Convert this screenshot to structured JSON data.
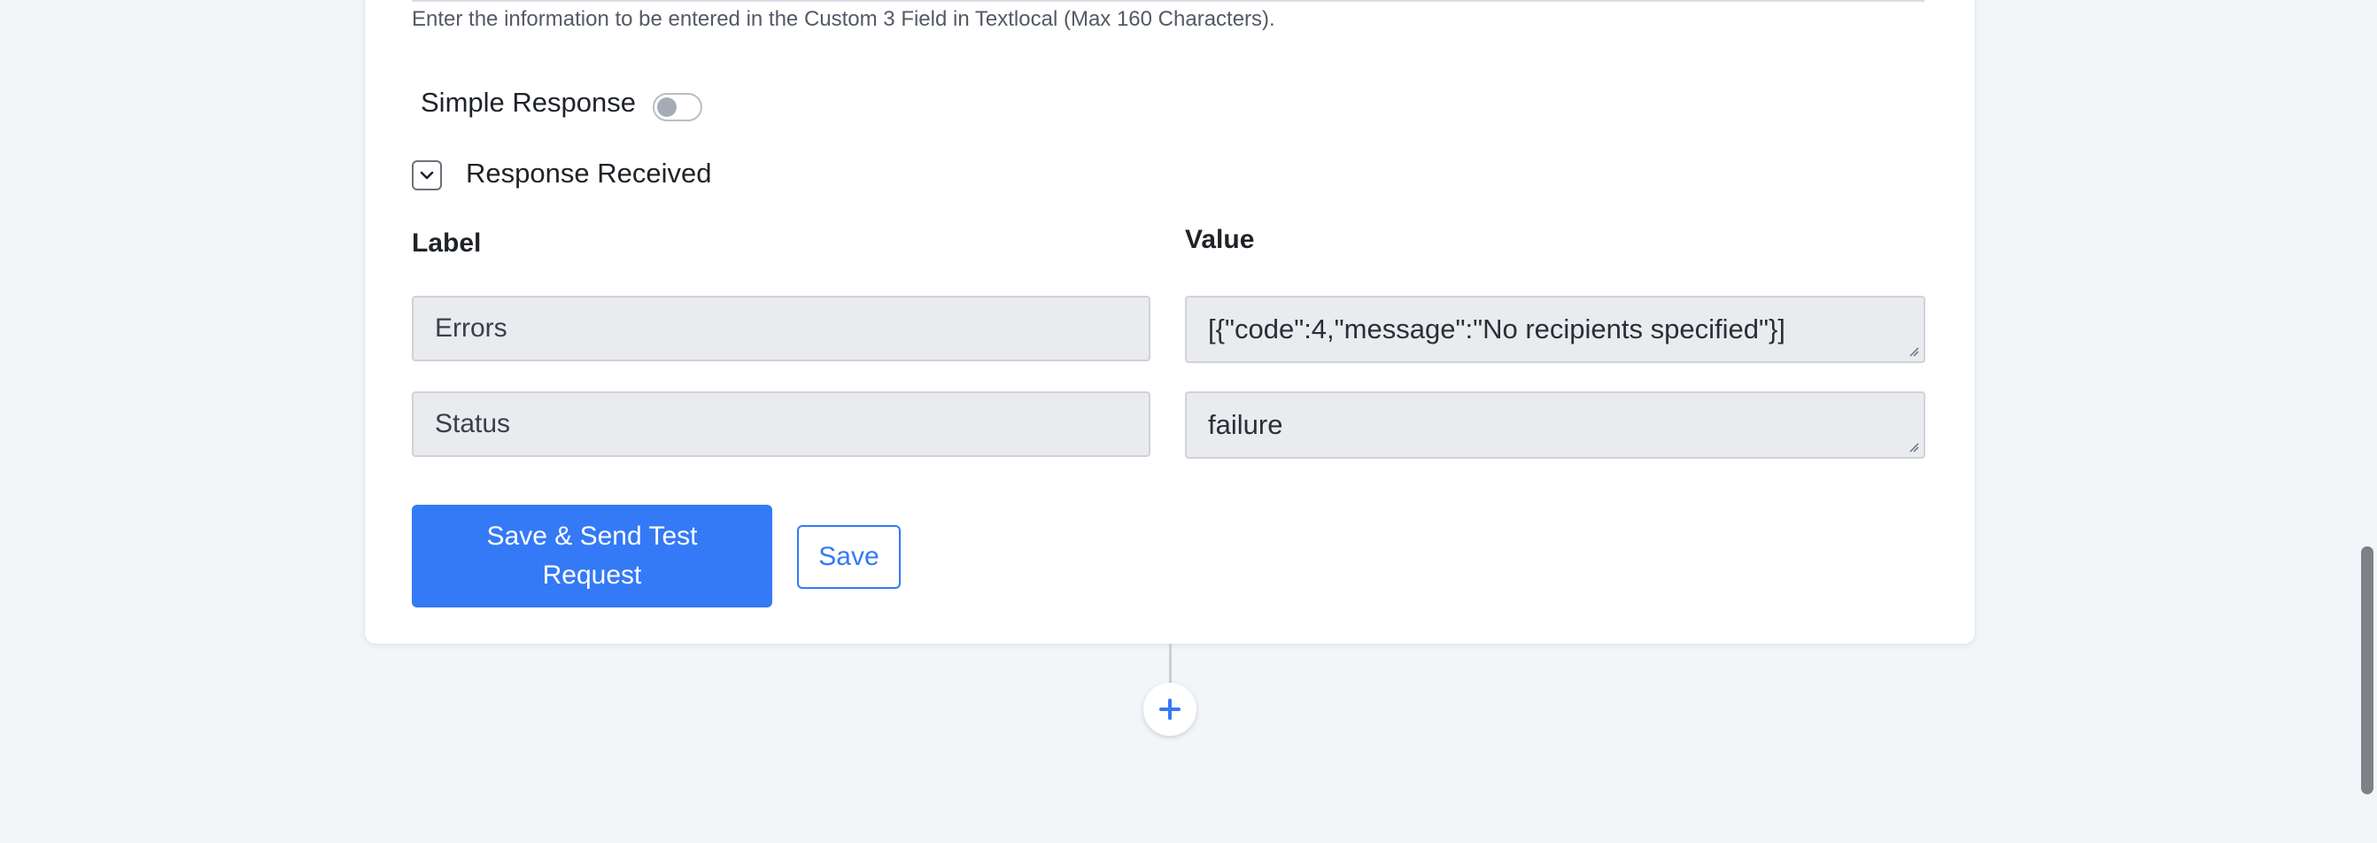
{
  "form": {
    "helper_text": "Enter the information to be entered in the Custom 3 Field in Textlocal (Max 160 Characters).",
    "simple_response": {
      "label": "Simple Response",
      "enabled": false
    },
    "response_section": {
      "title": "Response Received",
      "expanded": true
    },
    "columns": {
      "label": "Label",
      "value": "Value"
    },
    "rows": [
      {
        "label": "Errors",
        "value": "[{\"code\":4,\"message\":\"No recipients specified\"}]"
      },
      {
        "label": "Status",
        "value": "failure"
      }
    ]
  },
  "actions": {
    "save_and_send_label": "Save & Send Test Request",
    "save_label": "Save"
  },
  "icons": {
    "collapse": "chevron-down-icon",
    "add_step": "plus-icon"
  },
  "colors": {
    "primary": "#3479f6",
    "background": "#f3f6f9",
    "card": "#ffffff",
    "field_background": "#e9ebee"
  }
}
